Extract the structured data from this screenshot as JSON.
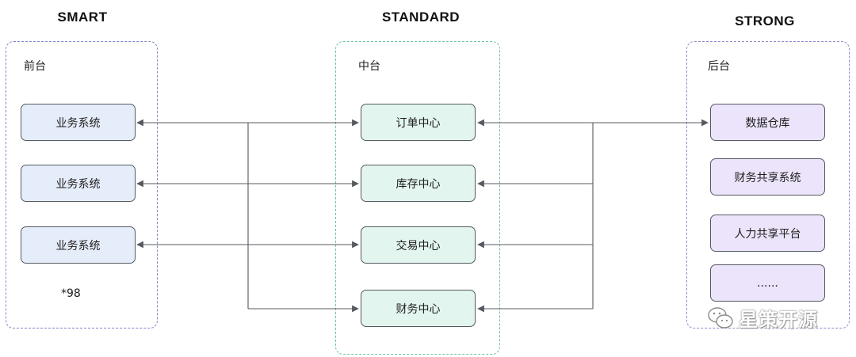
{
  "columns": {
    "smart": {
      "title": "SMART",
      "panel_label": "前台",
      "nodes": [
        "业务系统",
        "业务系统",
        "业务系统"
      ],
      "note": "*98"
    },
    "standard": {
      "title": "STANDARD",
      "panel_label": "中台",
      "nodes": [
        "订单中心",
        "库存中心",
        "交易中心",
        "财务中心"
      ]
    },
    "strong": {
      "title": "STRONG",
      "panel_label": "后台",
      "nodes": [
        "数据仓库",
        "财务共享系统",
        "人力共享平台",
        "......"
      ]
    }
  },
  "watermark": {
    "text": "星策开源",
    "icon": "wechat-icon"
  },
  "colors": {
    "smart_node_fill": "#e6edfa",
    "standard_node_fill": "#e2f5ef",
    "strong_node_fill": "#ece4fa",
    "connector": "#555a60"
  }
}
